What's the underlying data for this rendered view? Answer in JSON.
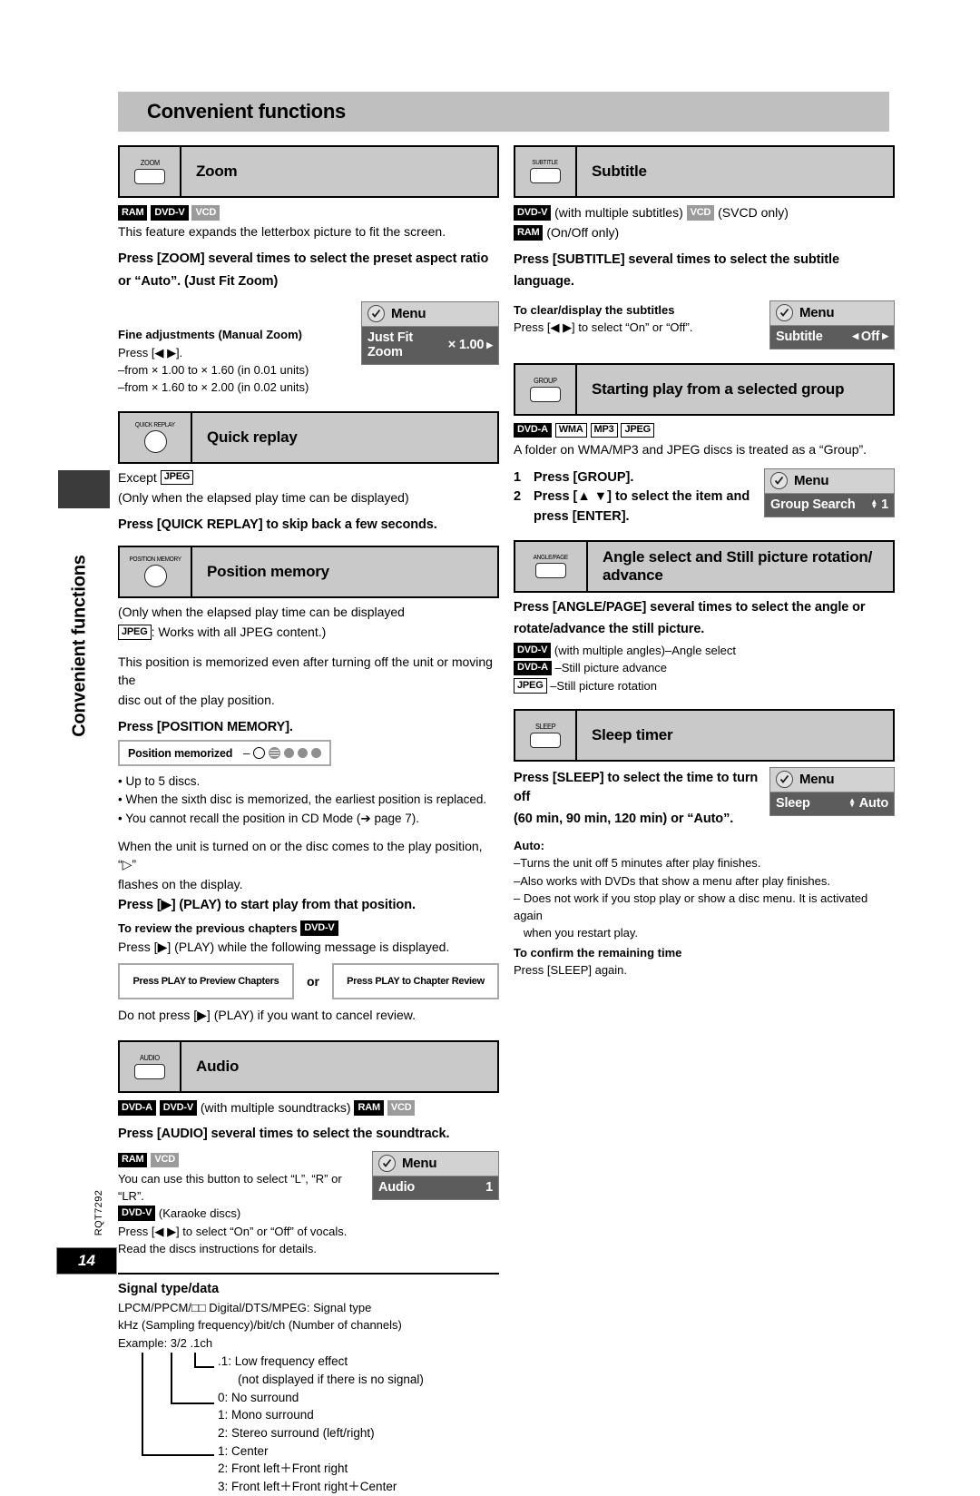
{
  "page": {
    "header_title": "Convenient functions",
    "side_tab_title": "Convenient functions",
    "rqt_code": "RQT7292",
    "page_number": "14",
    "menu_word": "Menu"
  },
  "zoom_section": {
    "button_label": "ZOOM",
    "title": "Zoom",
    "badges": [
      {
        "text": "RAM",
        "style": "black"
      },
      {
        "text": "DVD-V",
        "style": "black"
      },
      {
        "text": "VCD",
        "style": "gray"
      }
    ],
    "intro": "This feature expands the letterbox picture to fit the screen.",
    "instruction_line1": "Press [ZOOM] several times to select the preset aspect ratio",
    "instruction_line2": "or “Auto”. (Just Fit Zoom)",
    "fine_heading": "Fine adjustments (Manual Zoom)",
    "fine_press": "Press [◀ ▶].",
    "fine_range1": "–from × 1.00 to × 1.60 (in 0.01 units)",
    "fine_range2": "–from × 1.60 to × 2.00 (in 0.02 units)",
    "osd": {
      "item": "Just Fit Zoom",
      "value": "× 1.00"
    }
  },
  "quick_replay": {
    "button_label": "QUICK REPLAY",
    "title": "Quick replay",
    "except_prefix": "Except",
    "except_badge": "JPEG",
    "note": "(Only when the elapsed play time can be displayed)",
    "instruction": "Press [QUICK REPLAY] to skip back a few seconds."
  },
  "position_memory": {
    "button_label": "POSITION MEMORY",
    "title": "Position memory",
    "note_line1": "(Only when the elapsed play time can be displayed",
    "note_badge": "JPEG",
    "note_line2": ": Works with all JPEG content.)",
    "body_line1": "This position is memorized even after turning off the unit or moving the",
    "body_line2": "disc out of the play position.",
    "instruction": "Press [POSITION MEMORY].",
    "display_label": "Position memorized",
    "bullets": [
      "• Up to 5 discs.",
      "• When the sixth disc is memorized, the earliest position is replaced.",
      "• You cannot recall the position in CD Mode (➔ page 7)."
    ],
    "resume_line1": "When the unit is turned on or the disc comes to the play position, “▷”",
    "resume_line2": "flashes on the display.",
    "resume_instruction": "Press [▶] (PLAY) to start play from that position.",
    "review_heading": "To review the previous chapters",
    "review_badge": "DVD-V",
    "review_body": "Press [▶] (PLAY) while the following message is displayed.",
    "msg_box_1": "Press PLAY to Preview Chapters",
    "msg_or": "or",
    "msg_box_2": "Press PLAY to Chapter Review",
    "cancel_note": "Do not press [▶] (PLAY) if you want to cancel review."
  },
  "audio_section": {
    "button_label": "AUDIO",
    "title": "Audio",
    "badges_line1": [
      {
        "text": "DVD-A",
        "style": "black"
      },
      {
        "text": "DVD-V",
        "style": "black"
      }
    ],
    "badges_line1_mid": "(with multiple soundtracks)",
    "badges_line1_end": [
      {
        "text": "RAM",
        "style": "black"
      },
      {
        "text": "VCD",
        "style": "gray"
      }
    ],
    "instruction": "Press [AUDIO] several times to select the soundtrack.",
    "sub_badges": [
      {
        "text": "RAM",
        "style": "black"
      },
      {
        "text": "VCD",
        "style": "gray"
      }
    ],
    "sub_line1": "You can use this button to select “L”, “R” or “LR”.",
    "karaoke_badge": "DVD-V",
    "karaoke_text": "(Karaoke discs)",
    "sub_line2": "Press [◀ ▶] to select “On” or “Off” of vocals.",
    "sub_line3": "Read the discs instructions for details.",
    "osd": {
      "item": "Audio",
      "value": "1"
    }
  },
  "signal_type": {
    "heading": "Signal type/data",
    "line1": "LPCM/PPCM/□□ Digital/DTS/MPEG:  Signal type",
    "line2": "kHz (Sampling frequency)/bit/ch (Number of channels)",
    "line3": "Example: 3/2 .1ch",
    "rows": [
      ".1: Low frequency effect",
      "(not displayed if there is no signal)",
      "0: No surround",
      "1: Mono surround",
      "2: Stereo surround (left/right)",
      "1: Center",
      "2: Front left＋Front right",
      "3: Front left＋Front right＋Center"
    ]
  },
  "subtitle_section": {
    "button_label": "SUBTITLE",
    "title": "Subtitle",
    "badge_dvdv": "DVD-V",
    "badge_dvdv_note": "(with multiple subtitles)",
    "badge_vcd": "VCD",
    "badge_vcd_note": "(SVCD only)",
    "badge_ram": "RAM",
    "badge_ram_note": "(On/Off only)",
    "instruction_line1": "Press [SUBTITLE] several times to select the subtitle",
    "instruction_line2": "language.",
    "clear_heading": "To clear/display the subtitles",
    "clear_body": "Press [◀ ▶] to select “On” or “Off”.",
    "osd": {
      "item": "Subtitle",
      "value": "Off"
    }
  },
  "group_section": {
    "button_label": "GROUP",
    "title": "Starting play from a selected group",
    "badges": [
      {
        "text": "DVD-A",
        "style": "black"
      },
      {
        "text": "WMA",
        "style": "outline"
      },
      {
        "text": "MP3",
        "style": "outline"
      },
      {
        "text": "JPEG",
        "style": "outline"
      }
    ],
    "intro": "A folder on WMA/MP3 and JPEG discs is treated as a “Group”.",
    "steps": [
      {
        "num": "1",
        "text": "Press [GROUP]."
      },
      {
        "num": "2",
        "text": "Press [▲ ▼] to select the item and"
      },
      {
        "num": "",
        "text": "press [ENTER]."
      }
    ],
    "osd": {
      "item": "Group Search",
      "value": "1"
    }
  },
  "angle_section": {
    "button_label": "ANGLE/PAGE",
    "title_line1": "Angle select and Still picture rotation/",
    "title_line2": "advance",
    "instruction_line1": "Press [ANGLE/PAGE] several times to select the angle or",
    "instruction_line2": "rotate/advance the still picture.",
    "rows": [
      {
        "badge": "DVD-V",
        "style": "black",
        "text": "(with multiple angles)–Angle select"
      },
      {
        "badge": "DVD-A",
        "style": "black",
        "text": "–Still picture advance"
      },
      {
        "badge": "JPEG",
        "style": "outline",
        "text": "–Still picture rotation"
      }
    ]
  },
  "sleep_section": {
    "button_label": "SLEEP",
    "title": "Sleep timer",
    "instruction_line1": "Press [SLEEP] to select the time to turn off",
    "instruction_line2": "(60 min, 90 min, 120 min) or “Auto”.",
    "auto_heading": "Auto:",
    "auto_lines": [
      "–Turns the unit off 5 minutes after play finishes.",
      "–Also works with DVDs that show a menu after play finishes.",
      "– Does not work if you stop play or show a disc menu. It is activated again",
      "   when you restart play."
    ],
    "confirm_heading": "To confirm the remaining time",
    "confirm_body": "Press [SLEEP] again.",
    "osd": {
      "item": "Sleep",
      "value": "Auto"
    }
  }
}
